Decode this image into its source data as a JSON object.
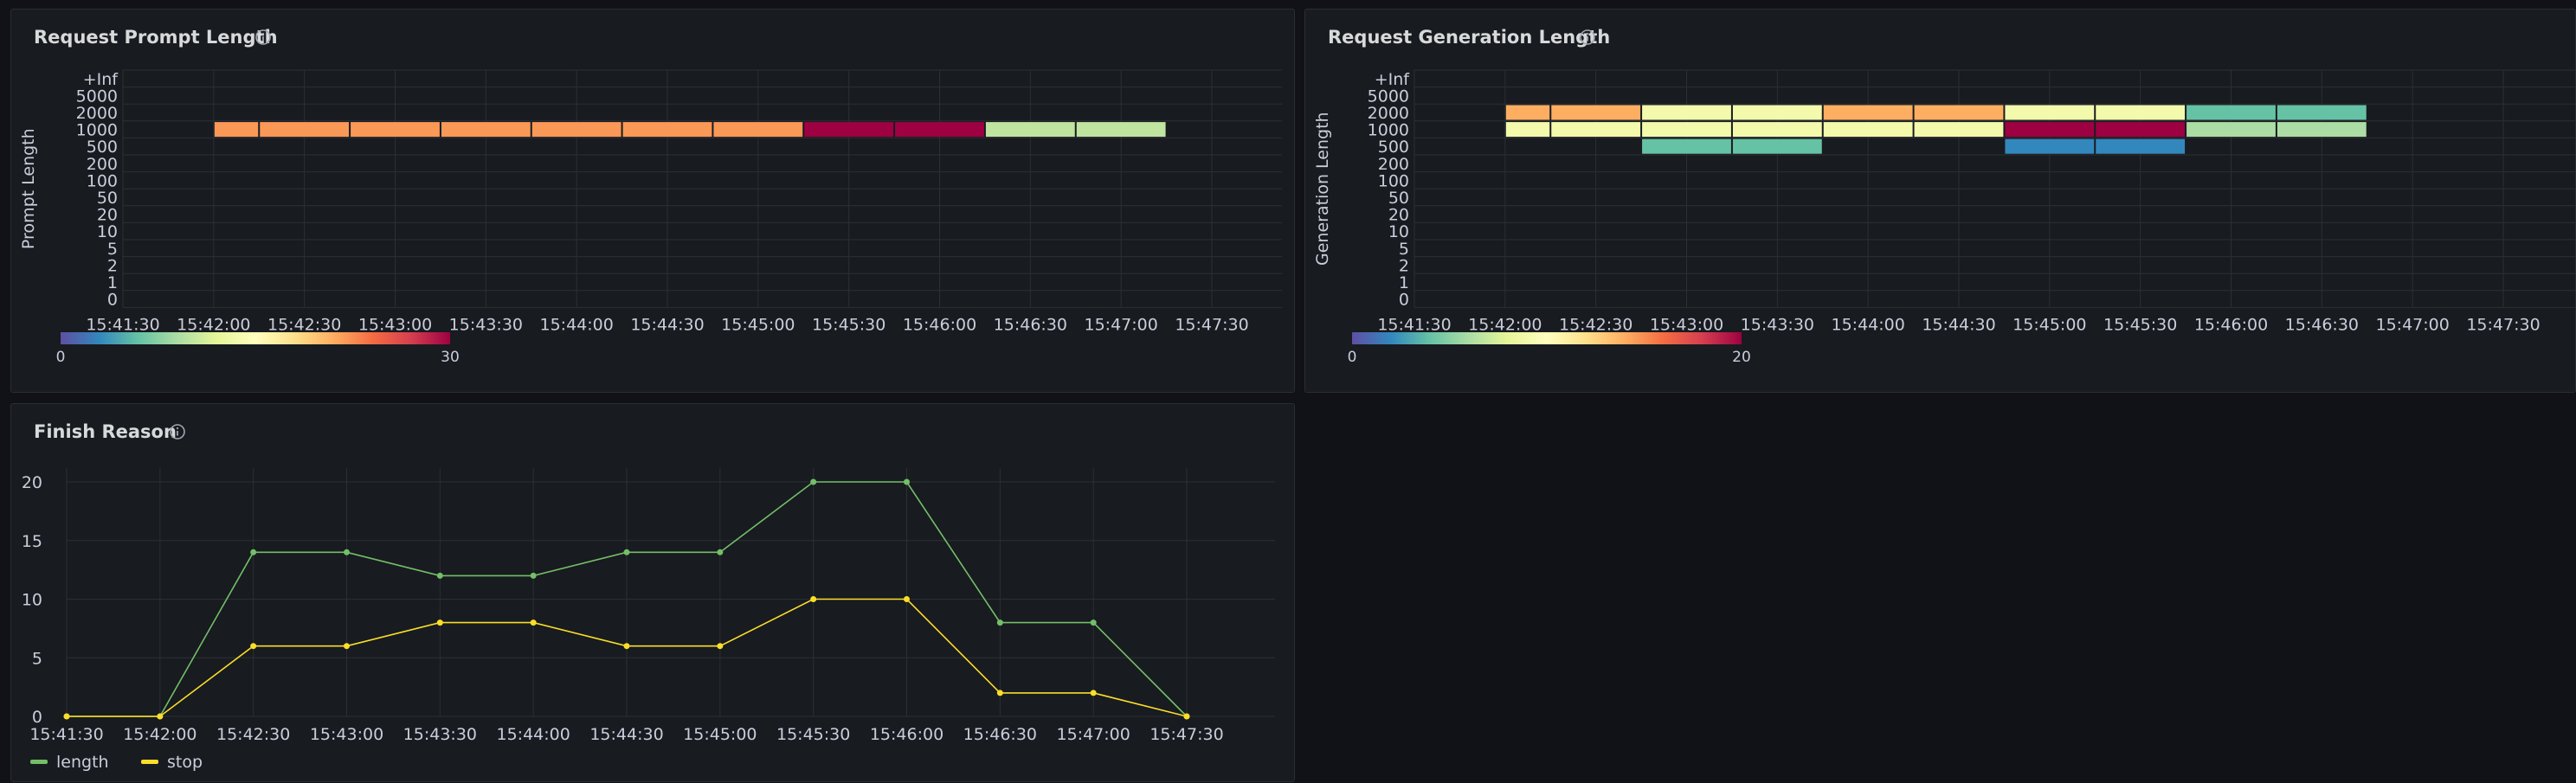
{
  "panels": [
    {
      "title": "Request Prompt Length",
      "info_icon": "info-circle-icon"
    },
    {
      "title": "Request Generation Length",
      "info_icon": "info-circle-icon"
    },
    {
      "title": "Finish Reason",
      "info_icon": "info-circle-icon"
    }
  ],
  "colors": {
    "background": "#111217",
    "panel": "#181b1f",
    "grid": "#2c2f35",
    "text": "#ccccdc",
    "length_series": "#73bf69",
    "stop_series": "#fade2a"
  },
  "chart_data": [
    {
      "type": "heatmap",
      "title": "Request Prompt Length",
      "ylabel": "Prompt Length",
      "y_buckets": [
        "0",
        "1",
        "2",
        "5",
        "10",
        "20",
        "50",
        "100",
        "200",
        "500",
        "1000",
        "2000",
        "5000",
        "+Inf"
      ],
      "x_ticks": [
        "15:41:30",
        "15:42:00",
        "15:42:30",
        "15:43:00",
        "15:43:30",
        "15:44:00",
        "15:44:30",
        "15:45:00",
        "15:45:30",
        "15:46:00",
        "15:46:30",
        "15:47:00",
        "15:47:30"
      ],
      "bucket_width_seconds": 15,
      "cells": [
        {
          "x_start": "15:42:00",
          "x_end": "15:42:15",
          "bucket": "1000",
          "value": 22
        },
        {
          "x_start": "15:42:15",
          "x_end": "15:42:45",
          "bucket": "1000",
          "value": 22
        },
        {
          "x_start": "15:42:45",
          "x_end": "15:43:15",
          "bucket": "1000",
          "value": 22
        },
        {
          "x_start": "15:43:15",
          "x_end": "15:43:45",
          "bucket": "1000",
          "value": 22
        },
        {
          "x_start": "15:43:45",
          "x_end": "15:44:15",
          "bucket": "1000",
          "value": 22
        },
        {
          "x_start": "15:44:15",
          "x_end": "15:44:45",
          "bucket": "1000",
          "value": 22
        },
        {
          "x_start": "15:44:45",
          "x_end": "15:45:15",
          "bucket": "1000",
          "value": 22
        },
        {
          "x_start": "15:45:15",
          "x_end": "15:45:45",
          "bucket": "1000",
          "value": 30
        },
        {
          "x_start": "15:45:45",
          "x_end": "15:46:15",
          "bucket": "1000",
          "value": 30
        },
        {
          "x_start": "15:46:15",
          "x_end": "15:46:45",
          "bucket": "1000",
          "value": 10
        },
        {
          "x_start": "15:46:45",
          "x_end": "15:47:15",
          "bucket": "1000",
          "value": 10
        }
      ],
      "scale": {
        "min": 0,
        "max": 30,
        "min_label": "0",
        "max_label": "30",
        "scheme": "Spectral"
      }
    },
    {
      "type": "heatmap",
      "title": "Request Generation Length",
      "ylabel": "Generation Length",
      "y_buckets": [
        "0",
        "1",
        "2",
        "5",
        "10",
        "20",
        "50",
        "100",
        "200",
        "500",
        "1000",
        "2000",
        "5000",
        "+Inf"
      ],
      "x_ticks": [
        "15:41:30",
        "15:42:00",
        "15:42:30",
        "15:43:00",
        "15:43:30",
        "15:44:00",
        "15:44:30",
        "15:45:00",
        "15:45:30",
        "15:46:00",
        "15:46:30",
        "15:47:00",
        "15:47:30"
      ],
      "bucket_width_seconds": 15,
      "cells": [
        {
          "x_start": "15:42:00",
          "x_end": "15:42:15",
          "bucket": "2000",
          "value": 14
        },
        {
          "x_start": "15:42:15",
          "x_end": "15:42:45",
          "bucket": "2000",
          "value": 14
        },
        {
          "x_start": "15:42:45",
          "x_end": "15:43:15",
          "bucket": "2000",
          "value": 9
        },
        {
          "x_start": "15:43:15",
          "x_end": "15:43:45",
          "bucket": "2000",
          "value": 9
        },
        {
          "x_start": "15:43:45",
          "x_end": "15:44:15",
          "bucket": "2000",
          "value": 14
        },
        {
          "x_start": "15:44:15",
          "x_end": "15:44:45",
          "bucket": "2000",
          "value": 14
        },
        {
          "x_start": "15:44:45",
          "x_end": "15:45:15",
          "bucket": "2000",
          "value": 9
        },
        {
          "x_start": "15:45:15",
          "x_end": "15:45:45",
          "bucket": "2000",
          "value": 9
        },
        {
          "x_start": "15:45:45",
          "x_end": "15:46:15",
          "bucket": "2000",
          "value": 4
        },
        {
          "x_start": "15:46:15",
          "x_end": "15:46:45",
          "bucket": "2000",
          "value": 4
        },
        {
          "x_start": "15:42:00",
          "x_end": "15:42:15",
          "bucket": "1000",
          "value": 9
        },
        {
          "x_start": "15:42:15",
          "x_end": "15:42:45",
          "bucket": "1000",
          "value": 9
        },
        {
          "x_start": "15:42:45",
          "x_end": "15:43:15",
          "bucket": "1000",
          "value": 9
        },
        {
          "x_start": "15:43:15",
          "x_end": "15:43:45",
          "bucket": "1000",
          "value": 9
        },
        {
          "x_start": "15:43:45",
          "x_end": "15:44:15",
          "bucket": "1000",
          "value": 9
        },
        {
          "x_start": "15:44:15",
          "x_end": "15:44:45",
          "bucket": "1000",
          "value": 9
        },
        {
          "x_start": "15:44:45",
          "x_end": "15:45:15",
          "bucket": "1000",
          "value": 20
        },
        {
          "x_start": "15:45:15",
          "x_end": "15:45:45",
          "bucket": "1000",
          "value": 20
        },
        {
          "x_start": "15:45:45",
          "x_end": "15:46:15",
          "bucket": "1000",
          "value": 6
        },
        {
          "x_start": "15:46:15",
          "x_end": "15:46:45",
          "bucket": "1000",
          "value": 6
        },
        {
          "x_start": "15:42:45",
          "x_end": "15:43:15",
          "bucket": "500",
          "value": 4
        },
        {
          "x_start": "15:43:15",
          "x_end": "15:43:45",
          "bucket": "500",
          "value": 4
        },
        {
          "x_start": "15:44:45",
          "x_end": "15:45:15",
          "bucket": "500",
          "value": 2
        },
        {
          "x_start": "15:45:15",
          "x_end": "15:45:45",
          "bucket": "500",
          "value": 2
        }
      ],
      "scale": {
        "min": 0,
        "max": 20,
        "min_label": "0",
        "max_label": "20",
        "scheme": "Spectral"
      }
    },
    {
      "type": "line",
      "title": "Finish Reason",
      "x": [
        "15:41:30",
        "15:42:00",
        "15:42:30",
        "15:43:00",
        "15:43:30",
        "15:44:00",
        "15:44:30",
        "15:45:00",
        "15:45:30",
        "15:46:00",
        "15:46:30",
        "15:47:00",
        "15:47:30"
      ],
      "series": [
        {
          "name": "length",
          "color": "#73bf69",
          "values": [
            0,
            0,
            14,
            14,
            12,
            12,
            14,
            14,
            20,
            20,
            8,
            8,
            0
          ]
        },
        {
          "name": "stop",
          "color": "#fade2a",
          "values": [
            0,
            0,
            6,
            6,
            8,
            8,
            6,
            6,
            10,
            10,
            2,
            2,
            0
          ]
        }
      ],
      "y_ticks": [
        "0",
        "5",
        "10",
        "15",
        "20"
      ],
      "ylim": [
        0,
        21
      ],
      "grid": true,
      "legend": "bottom-left"
    }
  ]
}
